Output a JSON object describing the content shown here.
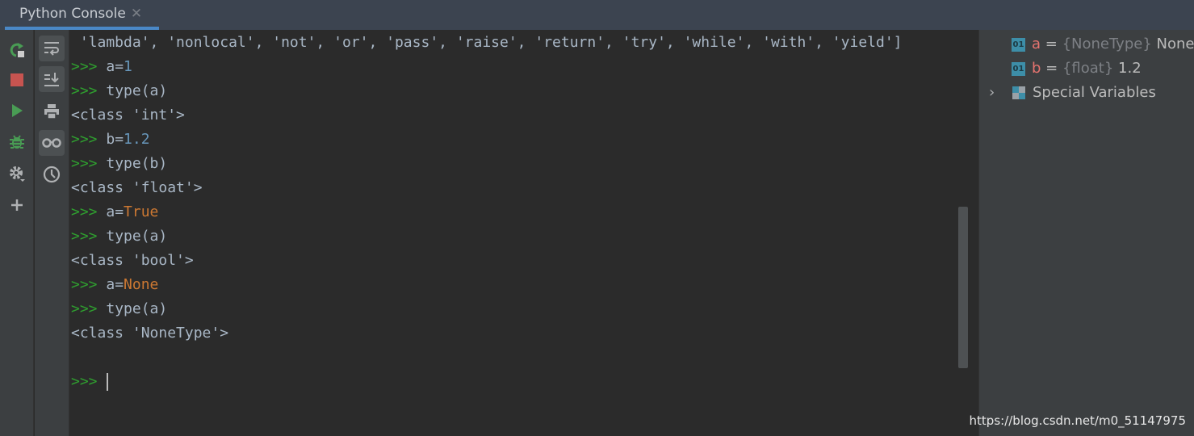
{
  "tab": {
    "title": "Python Console",
    "close": "✕"
  },
  "console": {
    "lines": [
      {
        "parts": [
          {
            "t": " 'lambda', 'nonlocal', 'not', 'or', 'pass', 'raise', 'return', 'try', 'while', 'with', 'yield']",
            "c": ""
          }
        ]
      },
      {
        "parts": [
          {
            "t": ">>> ",
            "c": "pr"
          },
          {
            "t": "a=",
            "c": ""
          },
          {
            "t": "1",
            "c": "num"
          }
        ]
      },
      {
        "parts": [
          {
            "t": ">>> ",
            "c": "pr"
          },
          {
            "t": "type(a)",
            "c": ""
          }
        ]
      },
      {
        "parts": [
          {
            "t": "<class 'int'>",
            "c": ""
          }
        ]
      },
      {
        "parts": [
          {
            "t": ">>> ",
            "c": "pr"
          },
          {
            "t": "b=",
            "c": ""
          },
          {
            "t": "1.2",
            "c": "num"
          }
        ]
      },
      {
        "parts": [
          {
            "t": ">>> ",
            "c": "pr"
          },
          {
            "t": "type(b)",
            "c": ""
          }
        ]
      },
      {
        "parts": [
          {
            "t": "<class 'float'>",
            "c": ""
          }
        ]
      },
      {
        "parts": [
          {
            "t": ">>> ",
            "c": "pr"
          },
          {
            "t": "a=",
            "c": ""
          },
          {
            "t": "True",
            "c": "kw"
          }
        ]
      },
      {
        "parts": [
          {
            "t": ">>> ",
            "c": "pr"
          },
          {
            "t": "type(a)",
            "c": ""
          }
        ]
      },
      {
        "parts": [
          {
            "t": "<class 'bool'>",
            "c": ""
          }
        ]
      },
      {
        "parts": [
          {
            "t": ">>> ",
            "c": "pr"
          },
          {
            "t": "a=",
            "c": ""
          },
          {
            "t": "None",
            "c": "kw"
          }
        ]
      },
      {
        "parts": [
          {
            "t": ">>> ",
            "c": "pr"
          },
          {
            "t": "type(a)",
            "c": ""
          }
        ]
      },
      {
        "parts": [
          {
            "t": "<class 'NoneType'>",
            "c": ""
          }
        ]
      },
      {
        "parts": []
      }
    ],
    "prompt": ">>> "
  },
  "variables": [
    {
      "name": "a",
      "type": "{NoneType}",
      "value": "None",
      "icon": "01"
    },
    {
      "name": "b",
      "type": "{float}",
      "value": "1.2",
      "icon": "01"
    }
  ],
  "special_variables": "Special Variables",
  "watermark": "https://blog.csdn.net/m0_51147975",
  "colors": {
    "prompt": "#2f9f2f",
    "number": "#6897bb",
    "keyword": "#cc7832",
    "accent": "#4a88c7"
  }
}
